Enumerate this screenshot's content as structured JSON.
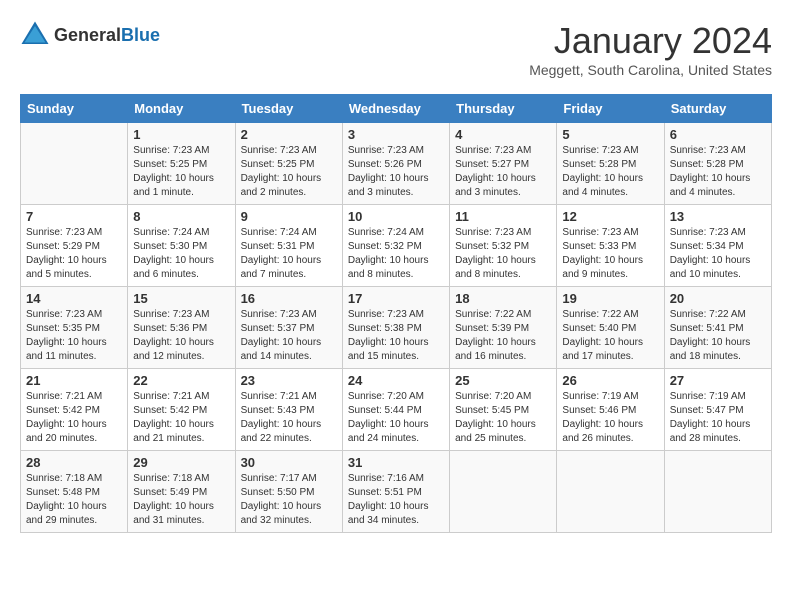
{
  "header": {
    "logo_general": "General",
    "logo_blue": "Blue",
    "month": "January 2024",
    "location": "Meggett, South Carolina, United States"
  },
  "days_of_week": [
    "Sunday",
    "Monday",
    "Tuesday",
    "Wednesday",
    "Thursday",
    "Friday",
    "Saturday"
  ],
  "weeks": [
    [
      {
        "day": "",
        "info": ""
      },
      {
        "day": "1",
        "info": "Sunrise: 7:23 AM\nSunset: 5:25 PM\nDaylight: 10 hours\nand 1 minute."
      },
      {
        "day": "2",
        "info": "Sunrise: 7:23 AM\nSunset: 5:25 PM\nDaylight: 10 hours\nand 2 minutes."
      },
      {
        "day": "3",
        "info": "Sunrise: 7:23 AM\nSunset: 5:26 PM\nDaylight: 10 hours\nand 3 minutes."
      },
      {
        "day": "4",
        "info": "Sunrise: 7:23 AM\nSunset: 5:27 PM\nDaylight: 10 hours\nand 3 minutes."
      },
      {
        "day": "5",
        "info": "Sunrise: 7:23 AM\nSunset: 5:28 PM\nDaylight: 10 hours\nand 4 minutes."
      },
      {
        "day": "6",
        "info": "Sunrise: 7:23 AM\nSunset: 5:28 PM\nDaylight: 10 hours\nand 4 minutes."
      }
    ],
    [
      {
        "day": "7",
        "info": "Sunrise: 7:23 AM\nSunset: 5:29 PM\nDaylight: 10 hours\nand 5 minutes."
      },
      {
        "day": "8",
        "info": "Sunrise: 7:24 AM\nSunset: 5:30 PM\nDaylight: 10 hours\nand 6 minutes."
      },
      {
        "day": "9",
        "info": "Sunrise: 7:24 AM\nSunset: 5:31 PM\nDaylight: 10 hours\nand 7 minutes."
      },
      {
        "day": "10",
        "info": "Sunrise: 7:24 AM\nSunset: 5:32 PM\nDaylight: 10 hours\nand 8 minutes."
      },
      {
        "day": "11",
        "info": "Sunrise: 7:23 AM\nSunset: 5:32 PM\nDaylight: 10 hours\nand 8 minutes."
      },
      {
        "day": "12",
        "info": "Sunrise: 7:23 AM\nSunset: 5:33 PM\nDaylight: 10 hours\nand 9 minutes."
      },
      {
        "day": "13",
        "info": "Sunrise: 7:23 AM\nSunset: 5:34 PM\nDaylight: 10 hours\nand 10 minutes."
      }
    ],
    [
      {
        "day": "14",
        "info": "Sunrise: 7:23 AM\nSunset: 5:35 PM\nDaylight: 10 hours\nand 11 minutes."
      },
      {
        "day": "15",
        "info": "Sunrise: 7:23 AM\nSunset: 5:36 PM\nDaylight: 10 hours\nand 12 minutes."
      },
      {
        "day": "16",
        "info": "Sunrise: 7:23 AM\nSunset: 5:37 PM\nDaylight: 10 hours\nand 14 minutes."
      },
      {
        "day": "17",
        "info": "Sunrise: 7:23 AM\nSunset: 5:38 PM\nDaylight: 10 hours\nand 15 minutes."
      },
      {
        "day": "18",
        "info": "Sunrise: 7:22 AM\nSunset: 5:39 PM\nDaylight: 10 hours\nand 16 minutes."
      },
      {
        "day": "19",
        "info": "Sunrise: 7:22 AM\nSunset: 5:40 PM\nDaylight: 10 hours\nand 17 minutes."
      },
      {
        "day": "20",
        "info": "Sunrise: 7:22 AM\nSunset: 5:41 PM\nDaylight: 10 hours\nand 18 minutes."
      }
    ],
    [
      {
        "day": "21",
        "info": "Sunrise: 7:21 AM\nSunset: 5:42 PM\nDaylight: 10 hours\nand 20 minutes."
      },
      {
        "day": "22",
        "info": "Sunrise: 7:21 AM\nSunset: 5:42 PM\nDaylight: 10 hours\nand 21 minutes."
      },
      {
        "day": "23",
        "info": "Sunrise: 7:21 AM\nSunset: 5:43 PM\nDaylight: 10 hours\nand 22 minutes."
      },
      {
        "day": "24",
        "info": "Sunrise: 7:20 AM\nSunset: 5:44 PM\nDaylight: 10 hours\nand 24 minutes."
      },
      {
        "day": "25",
        "info": "Sunrise: 7:20 AM\nSunset: 5:45 PM\nDaylight: 10 hours\nand 25 minutes."
      },
      {
        "day": "26",
        "info": "Sunrise: 7:19 AM\nSunset: 5:46 PM\nDaylight: 10 hours\nand 26 minutes."
      },
      {
        "day": "27",
        "info": "Sunrise: 7:19 AM\nSunset: 5:47 PM\nDaylight: 10 hours\nand 28 minutes."
      }
    ],
    [
      {
        "day": "28",
        "info": "Sunrise: 7:18 AM\nSunset: 5:48 PM\nDaylight: 10 hours\nand 29 minutes."
      },
      {
        "day": "29",
        "info": "Sunrise: 7:18 AM\nSunset: 5:49 PM\nDaylight: 10 hours\nand 31 minutes."
      },
      {
        "day": "30",
        "info": "Sunrise: 7:17 AM\nSunset: 5:50 PM\nDaylight: 10 hours\nand 32 minutes."
      },
      {
        "day": "31",
        "info": "Sunrise: 7:16 AM\nSunset: 5:51 PM\nDaylight: 10 hours\nand 34 minutes."
      },
      {
        "day": "",
        "info": ""
      },
      {
        "day": "",
        "info": ""
      },
      {
        "day": "",
        "info": ""
      }
    ]
  ]
}
